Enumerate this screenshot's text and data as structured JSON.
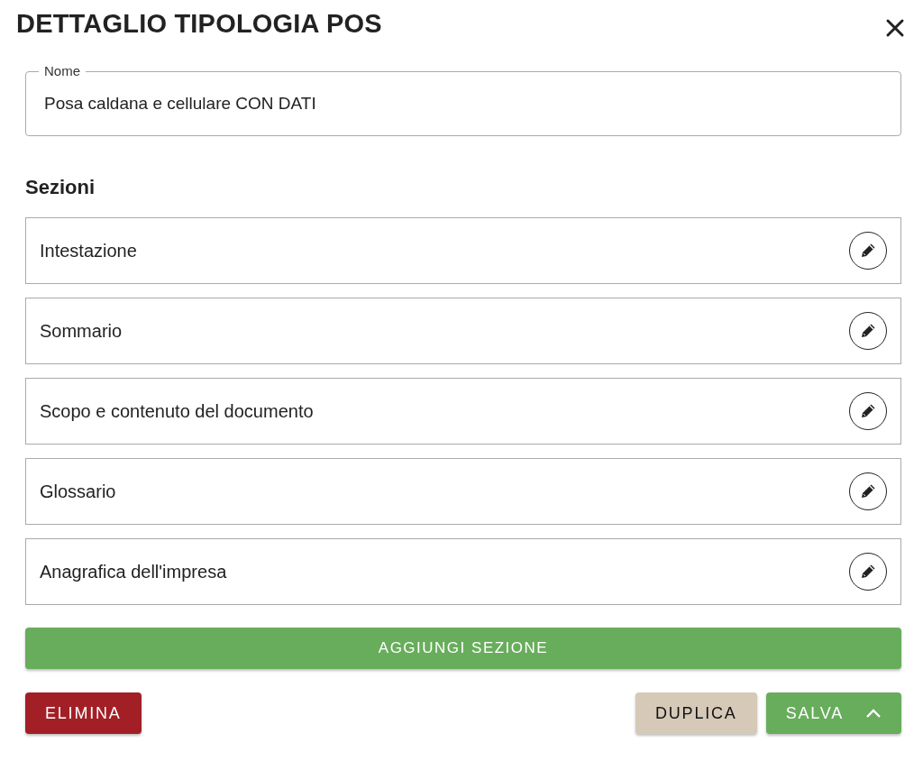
{
  "dialog": {
    "title": "DETTAGLIO TIPOLOGIA POS"
  },
  "name_field": {
    "label": "Nome",
    "value": "Posa caldana e cellulare CON DATI"
  },
  "sections": {
    "heading": "Sezioni",
    "items": [
      {
        "label": "Intestazione"
      },
      {
        "label": "Sommario"
      },
      {
        "label": "Scopo e contenuto del documento"
      },
      {
        "label": "Glossario"
      },
      {
        "label": "Anagrafica dell'impresa"
      }
    ]
  },
  "add_button": "AGGIUNGI SEZIONE",
  "buttons": [
    {
      "label": "ELIMINA",
      "kind": "danger"
    },
    {
      "label": "DUPLICA",
      "kind": "neutral"
    },
    {
      "label": "SALVA",
      "kind": "primary"
    }
  ]
}
